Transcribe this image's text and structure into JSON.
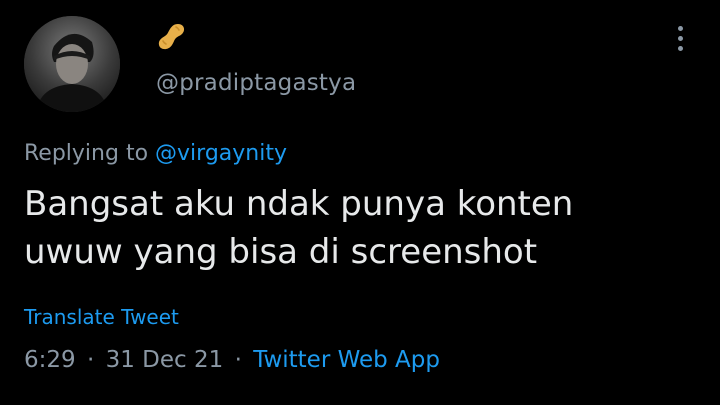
{
  "author": {
    "display_icon": "peanut-emoji",
    "handle": "@pradiptagastya"
  },
  "reply": {
    "prefix": "Replying to",
    "target": "@virgaynity"
  },
  "tweet": {
    "lines": [
      "Bangsat aku ndak punya konten",
      "uwuw yang bisa di screenshot"
    ]
  },
  "actions": {
    "translate_label": "Translate Tweet",
    "more_icon": "more-vertical-icon"
  },
  "meta": {
    "time": "6:29",
    "separator": "·",
    "date": "31 Dec 21",
    "source": "Twitter Web App"
  },
  "colors": {
    "background": "#000000",
    "text": "#e7e9ea",
    "secondary": "#8b98a5",
    "link": "#1d9bf0"
  }
}
